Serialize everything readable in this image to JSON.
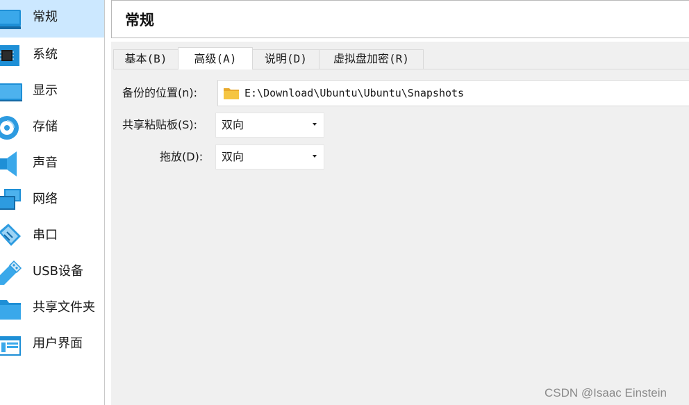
{
  "sidebar": {
    "items": [
      {
        "label": "常规",
        "icon": "monitor-icon",
        "selected": true
      },
      {
        "label": "系统",
        "icon": "chip-icon",
        "selected": false
      },
      {
        "label": "显示",
        "icon": "display-icon",
        "selected": false
      },
      {
        "label": "存储",
        "icon": "disk-icon",
        "selected": false
      },
      {
        "label": "声音",
        "icon": "speaker-icon",
        "selected": false
      },
      {
        "label": "网络",
        "icon": "network-icon",
        "selected": false
      },
      {
        "label": "串口",
        "icon": "serial-cable-icon",
        "selected": false
      },
      {
        "label": "USB设备",
        "icon": "usb-icon",
        "selected": false
      },
      {
        "label": "共享文件夹",
        "icon": "folder-icon",
        "selected": false
      },
      {
        "label": "用户界面",
        "icon": "window-icon",
        "selected": false
      }
    ]
  },
  "header": {
    "title": "常规"
  },
  "tabs": [
    {
      "label": "基本(B)",
      "active": false
    },
    {
      "label": "高级(A)",
      "active": true
    },
    {
      "label": "说明(D)",
      "active": false
    },
    {
      "label": "虚拟盘加密(R)",
      "active": false
    }
  ],
  "form": {
    "snapshot_label": "备份的位置(n):",
    "snapshot_path": "E:\\Download\\Ubuntu\\Ubuntu\\Snapshots",
    "clipboard_label": "共享粘贴板(S):",
    "clipboard_value": "双向",
    "dragdrop_label": "拖放(D):",
    "dragdrop_value": "双向"
  },
  "watermark": "CSDN @Isaac Einstein",
  "colors": {
    "selection": "#cce8ff",
    "icon_blue": "#1e8fd6",
    "folder_yellow": "#f5c542"
  }
}
